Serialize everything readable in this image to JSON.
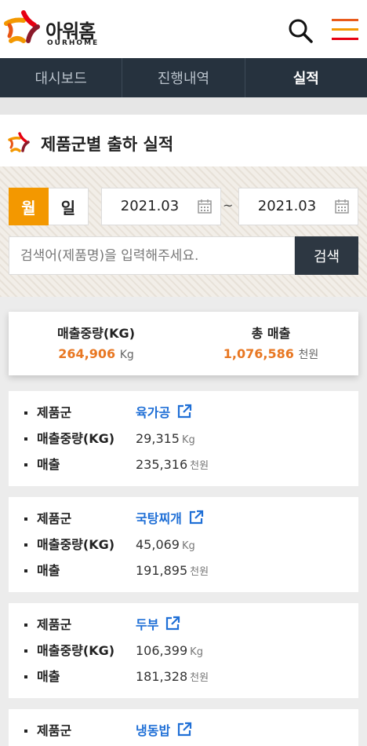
{
  "brand": {
    "name_ko": "아워홈",
    "name_en": "OURHOME"
  },
  "nav": {
    "tabs": [
      {
        "label": "대시보드",
        "active": false
      },
      {
        "label": "진행내역",
        "active": false
      },
      {
        "label": "실적",
        "active": true
      }
    ]
  },
  "section": {
    "title": "제품군별 출하 실적"
  },
  "filter": {
    "period_month": "월",
    "period_day": "일",
    "selected_period": "월",
    "start_date": "2021.03",
    "separator": "~",
    "end_date": "2021.03",
    "search_placeholder": "검색어(제품명)을 입력해주세요.",
    "search_value": "",
    "search_button": "검색"
  },
  "summary": {
    "weight_label": "매출중량(KG)",
    "weight_value": "264,906",
    "weight_unit": "Kg",
    "sales_label": "총 매출",
    "sales_value": "1,076,586",
    "sales_unit": "천원"
  },
  "labels": {
    "group": "제품군",
    "weight": "매출중량(KG)",
    "sales": "매출",
    "weight_unit": "Kg",
    "sales_unit": "천원"
  },
  "products": [
    {
      "group": "육가공",
      "weight": "29,315",
      "sales": "235,316"
    },
    {
      "group": "국탕찌개",
      "weight": "45,069",
      "sales": "191,895"
    },
    {
      "group": "두부",
      "weight": "106,399",
      "sales": "181,328"
    },
    {
      "group": "냉동밥",
      "weight": "",
      "sales": ""
    }
  ],
  "colors": {
    "accent": "#f39800",
    "nav_bg": "#26323e",
    "value_orange": "#e87722",
    "link_blue": "#1f6fd6",
    "search_button_bg": "#2d3742"
  },
  "icons": {
    "logo": "ourhome-logo-icon",
    "search": "search-icon",
    "menu": "hamburger-menu-icon",
    "calendar": "calendar-icon",
    "external": "external-link-icon"
  }
}
